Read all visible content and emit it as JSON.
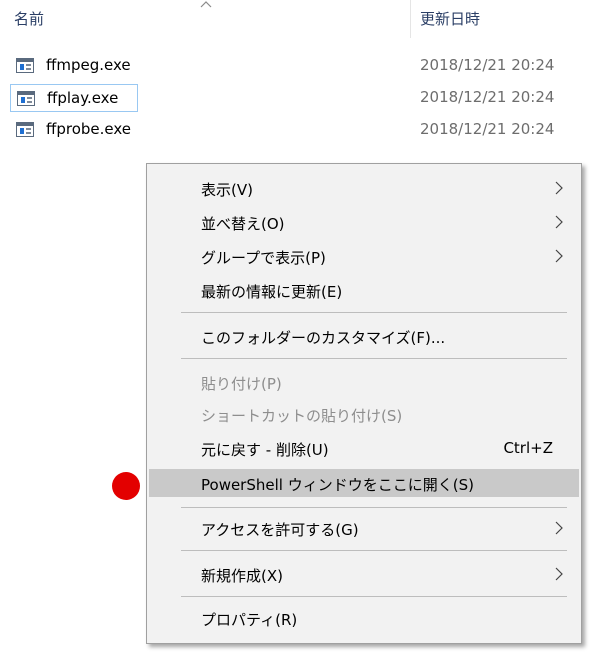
{
  "header": {
    "name_label": "名前",
    "date_label": "更新日時"
  },
  "files": [
    {
      "name": "ffmpeg.exe",
      "date": "2018/12/21 20:24"
    },
    {
      "name": "ffplay.exe",
      "date": "2018/12/21 20:24"
    },
    {
      "name": "ffprobe.exe",
      "date": "2018/12/21 20:24"
    }
  ],
  "context_menu": {
    "items": [
      {
        "label": "表示(V)",
        "submenu": true
      },
      {
        "label": "並べ替え(O)",
        "submenu": true
      },
      {
        "label": "グループで表示(P)",
        "submenu": true
      },
      {
        "label": "最新の情報に更新(E)"
      },
      {
        "label": "このフォルダーのカスタマイズ(F)..."
      },
      {
        "label": "貼り付け(P)",
        "disabled": true
      },
      {
        "label": "ショートカットの貼り付け(S)",
        "disabled": true
      },
      {
        "label": "元に戻す - 削除(U)",
        "shortcut": "Ctrl+Z"
      },
      {
        "label": "PowerShell ウィンドウをここに開く(S)",
        "highlighted": true
      },
      {
        "label": "アクセスを許可する(G)",
        "submenu": true
      },
      {
        "label": "新規作成(X)",
        "submenu": true
      },
      {
        "label": "プロパティ(R)"
      }
    ]
  },
  "colors": {
    "highlight": "#c9c9c9",
    "marker": "#e30000"
  }
}
